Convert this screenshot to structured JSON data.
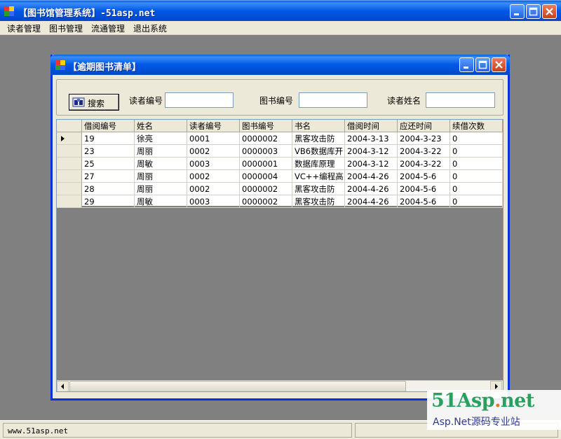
{
  "app": {
    "title": "【图书馆管理系统】-51asp.net",
    "menu": [
      "读者管理",
      "图书管理",
      "流通管理",
      "退出系统"
    ]
  },
  "child_window": {
    "title": "【逾期图书清单】",
    "search_button": "搜索",
    "labels": {
      "reader_id": "读者编号",
      "book_id": "图书编号",
      "reader_name": "读者姓名"
    },
    "inputs": {
      "reader_id": "",
      "book_id": "",
      "reader_name": ""
    }
  },
  "grid": {
    "columns": [
      "借阅编号",
      "姓名",
      "读者编号",
      "图书编号",
      "书名",
      "借阅时间",
      "应还时间",
      "续借次数"
    ],
    "rows": [
      [
        "19",
        "徐亮",
        "0001",
        "0000002",
        "黑客攻击防",
        "2004-3-13",
        "2004-3-23",
        "0"
      ],
      [
        "23",
        "周丽",
        "0002",
        "0000003",
        "VB6数据库开",
        "2004-3-12",
        "2004-3-22",
        "0"
      ],
      [
        "25",
        "周敏",
        "0003",
        "0000001",
        "数据库原理",
        "2004-3-12",
        "2004-3-22",
        "0"
      ],
      [
        "27",
        "周丽",
        "0002",
        "0000004",
        "VC++编程高",
        "2004-4-26",
        "2004-5-6",
        "0"
      ],
      [
        "28",
        "周丽",
        "0002",
        "0000002",
        "黑客攻击防",
        "2004-4-26",
        "2004-5-6",
        "0"
      ],
      [
        "29",
        "周敏",
        "0003",
        "0000002",
        "黑客攻击防",
        "2004-4-26",
        "2004-5-6",
        "0"
      ]
    ],
    "selected_row": 0
  },
  "status": {
    "text": "www.51asp.net"
  },
  "watermark": {
    "logo_main": "51Asp",
    "logo_dot": ".",
    "logo_net": "net",
    "subtitle": "Asp.Net源码专业站"
  },
  "colors": {
    "title_blue": "#0058e6",
    "face": "#ece9d8",
    "close_red": "#c8401c",
    "logo_green": "#2aa05e"
  }
}
